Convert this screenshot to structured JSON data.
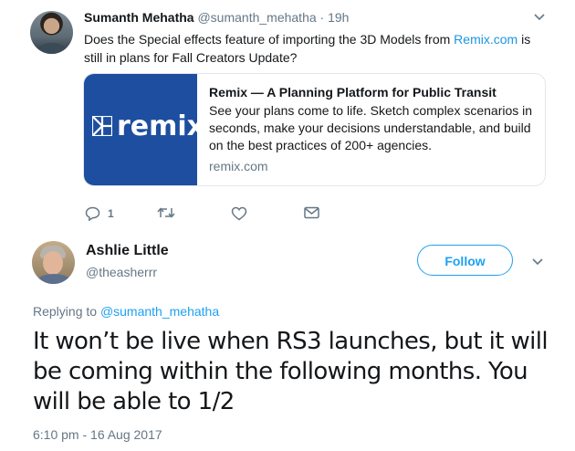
{
  "tweet1": {
    "name": "Sumanth Mehatha",
    "handle": "@sumanth_mehatha",
    "separator": " · ",
    "time": "19h",
    "text_before": "Does the Special effects feature of importing the 3D Models from ",
    "text_link": "Remix.com",
    "text_after": " is still in plans for Fall Creators Update?",
    "card": {
      "logo_word": "remix",
      "title": "Remix — A Planning Platform for Public Transit",
      "description": "See your plans come to life. Sketch complex scenarios in seconds, make your decisions understandable, and build on the best practices of 200+ agencies.",
      "domain": "remix.com",
      "brand_color": "#1d4ea0"
    },
    "actions": {
      "reply_count": "1",
      "icons": [
        "reply-icon",
        "retweet-icon",
        "like-icon",
        "direct-message-icon"
      ]
    }
  },
  "tweet2": {
    "name": "Ashlie Little",
    "handle": "@theasherrr",
    "follow_label": "Follow",
    "replying_prefix": "Replying to ",
    "replying_handle": "@sumanth_mehatha",
    "text": "It won’t be live when RS3 launches, but it will be coming within the following months. You will be able to 1/2",
    "timestamp": "6:10 pm - 16 Aug 2017"
  },
  "colors": {
    "accent": "#1da1f2",
    "link": "#1b95e0",
    "secondary_text": "#657786",
    "border": "#e1e8ed"
  }
}
